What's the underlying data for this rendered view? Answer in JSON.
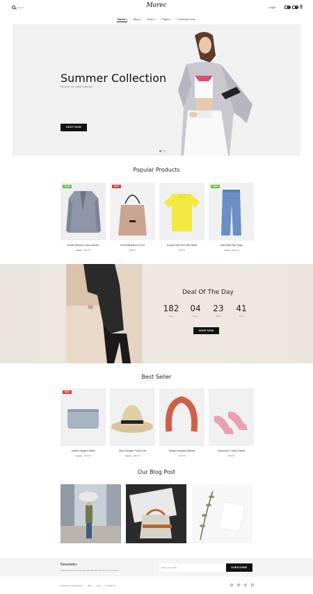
{
  "header": {
    "search_placeholder": "Search",
    "logo": "Morec",
    "login": "Login",
    "wishlist_count": "0",
    "cart_count": "0"
  },
  "nav": [
    {
      "label": "Home"
    },
    {
      "label": "Blog"
    },
    {
      "label": "Shop"
    },
    {
      "label": "Pages"
    },
    {
      "label": "Purchase Now"
    }
  ],
  "hero": {
    "title": "Summer Collection",
    "subtitle": "Discover our Latest Collection",
    "button": "SHOP NOW"
  },
  "popular": {
    "title": "Popular Products",
    "items": [
      {
        "badge": "SALE",
        "name": "Double Breasted Cotton Blazers",
        "old_price": "$89.00",
        "price": "$49.00"
      },
      {
        "badge": "NEW",
        "name": "Lolli Metal Bowl & In Hue",
        "old_price": "",
        "price": "$59.00"
      },
      {
        "badge": "",
        "name": "Duracie Plain Tree With Yellow",
        "old_price": "",
        "price": "$39.00"
      },
      {
        "badge": "SALE",
        "name": "Jeans Wide Big Length",
        "old_price": "$45.00",
        "price": "$30.00"
      }
    ]
  },
  "deal": {
    "title": "Deal Of The Day",
    "countdown": [
      {
        "value": "182",
        "label": "Days"
      },
      {
        "value": "04",
        "label": "Hours"
      },
      {
        "value": "23",
        "label": "Mins"
      },
      {
        "value": "41",
        "label": "Secs"
      }
    ],
    "button": "SHOP NOW"
  },
  "bestseller": {
    "title": "Best Seller",
    "items": [
      {
        "badge": "NEW",
        "name": "Leather Designer Wallet",
        "old_price": "$48.00",
        "price": "$38.00"
      },
      {
        "badge": "",
        "name": "Men's Designer Fedora Hat",
        "old_price": "$42.00",
        "price": "$30.00"
      },
      {
        "badge": "",
        "name": "Twisted Headband Bandan",
        "old_price": "",
        "price": "$18.00"
      },
      {
        "badge": "",
        "name": "Ohauzonde 2 Strike Pumice",
        "old_price": "",
        "price": "$49.00"
      }
    ]
  },
  "blog": {
    "title": "Our Blog Post"
  },
  "newsletter": {
    "title": "Newsletter",
    "subtitle": "Subscribe to our newsletter and get 15% off your first purchase",
    "placeholder": "Enter your email",
    "button": "SUBSCRIBE"
  },
  "footer": {
    "copyright": "Copyright © 2018 Morec",
    "links": [
      "Blog",
      "FAQ",
      "Contact us"
    ]
  }
}
